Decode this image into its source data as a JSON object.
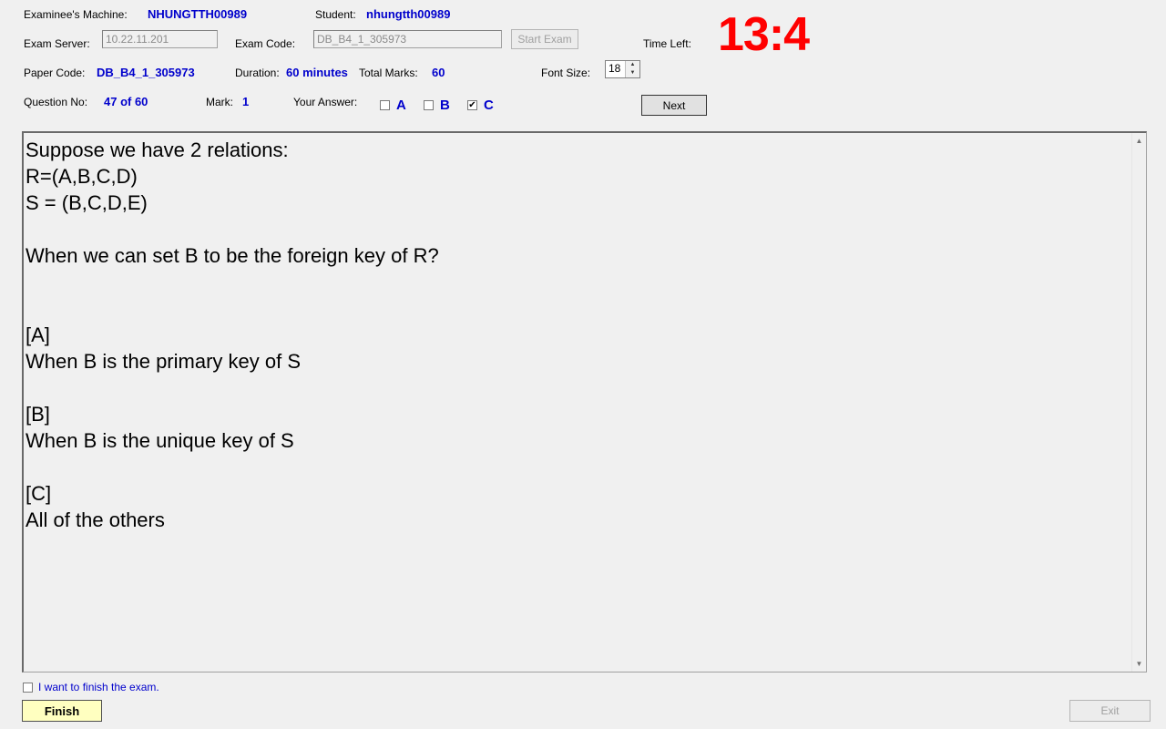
{
  "header": {
    "machine_label": "Examinee's Machine:",
    "machine_value": "NHUNGTTH00989",
    "student_label": "Student:",
    "student_value": "nhungtth00989",
    "server_label": "Exam Server:",
    "server_value": "10.22.11.201",
    "exam_code_label": "Exam Code:",
    "exam_code_value": "DB_B4_1_305973",
    "start_exam_label": "Start Exam",
    "time_left_label": "Time Left:",
    "time_left_value": "13:4",
    "paper_code_label": "Paper Code:",
    "paper_code_value": "DB_B4_1_305973",
    "duration_label": "Duration:",
    "duration_value": "60 minutes",
    "total_marks_label": "Total Marks:",
    "total_marks_value": "60",
    "font_size_label": "Font Size:",
    "font_size_value": "18",
    "question_no_label": "Question No:",
    "question_no_value": "47 of 60",
    "mark_label": "Mark:",
    "mark_value": "1",
    "your_answer_label": "Your Answer:",
    "next_label": "Next"
  },
  "answers": [
    {
      "label": "A",
      "checked": false
    },
    {
      "label": "B",
      "checked": false
    },
    {
      "label": "C",
      "checked": true
    }
  ],
  "question": {
    "lines": [
      "Suppose we have 2 relations:",
      "R=(A,B,C,D)",
      "S = (B,C,D,E)",
      "",
      "When we can set B to be the foreign key of R?",
      "",
      "",
      "[A]",
      "When B is the primary key of S",
      "",
      "[B]",
      "When B is the unique key of S",
      "",
      "[C]",
      "All of the others"
    ]
  },
  "footer": {
    "finish_check_label": "I want to finish the exam.",
    "finish_label": "Finish",
    "exit_label": "Exit"
  },
  "colors": {
    "accent_blue": "#0000cc",
    "timer_red": "#ff0000",
    "finish_bg": "#ffffc0"
  }
}
